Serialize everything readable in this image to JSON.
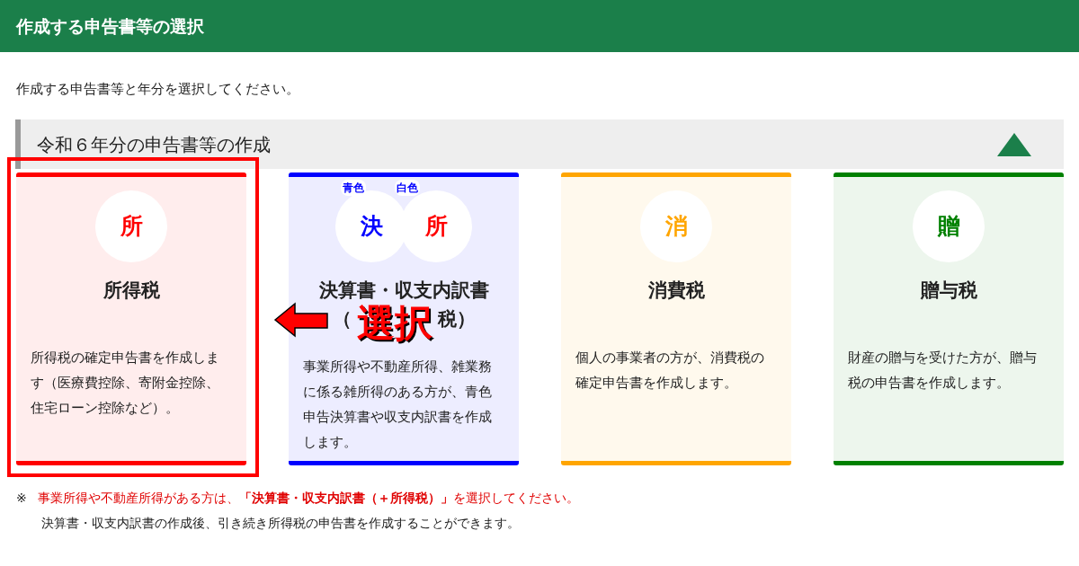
{
  "header": {
    "title": "作成する申告書等の選択"
  },
  "intro": "作成する申告書等と年分を選択してください。",
  "section": {
    "title": "令和６年分の申告書等の作成",
    "expanded": true
  },
  "cards": [
    {
      "kind": "single",
      "selected": true,
      "color": "#ff0000",
      "icons": [
        {
          "char": "所",
          "color": "#ff0000"
        }
      ],
      "title": "所得税",
      "description": "所得税の確定申告書を作成します（医療費控除、寄附金控除、住宅ローン控除など）。"
    },
    {
      "kind": "dual",
      "selected": false,
      "color": "#0000ff",
      "icons": [
        {
          "char": "決",
          "color": "#0000ff",
          "label": "青色"
        },
        {
          "char": "所",
          "color": "#ff0000",
          "label": "白色"
        }
      ],
      "title": "決算書・収支内訳書",
      "subtitle_parts": [
        "（",
        "税）"
      ],
      "description": "事業所得や不動産所得、雑業務に係る雑所得のある方が、青色申告決算書や収支内訳書を作成します。"
    },
    {
      "kind": "single",
      "selected": false,
      "color": "#ffa500",
      "icons": [
        {
          "char": "消",
          "color": "#ffa500"
        }
      ],
      "title": "消費税",
      "description": "個人の事業者の方が、消費税の確定申告書を作成します。"
    },
    {
      "kind": "single",
      "selected": false,
      "color": "#008000",
      "icons": [
        {
          "char": "贈",
          "color": "#008000"
        }
      ],
      "title": "贈与税",
      "description": "財産の贈与を受けた方が、贈与税の申告書を作成します。"
    }
  ],
  "annotation": {
    "text": "選択"
  },
  "notes": [
    {
      "mark": "※",
      "text": "事業所得や不動産所得がある方は、**「決算書・収支内訳書（＋所得税）」**を選択してください。",
      "kind": "warning"
    },
    {
      "text": "決算書・収支内訳書の作成後、引き続き所得税の申告書を作成することができます。",
      "kind": "plain"
    }
  ]
}
